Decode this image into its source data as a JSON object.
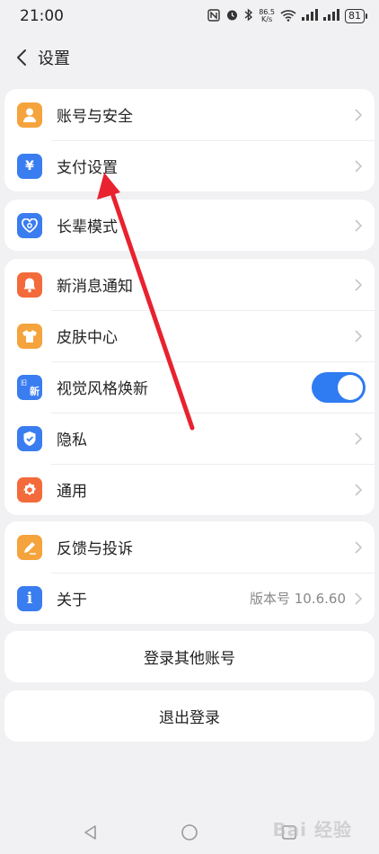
{
  "status": {
    "time": "21:00",
    "net_speed_top": "86.5",
    "net_speed_bottom": "K/s",
    "battery": "81"
  },
  "header": {
    "title": "设置"
  },
  "groups": {
    "account": {
      "account_security": {
        "label": "账号与安全",
        "icon": "person-icon",
        "color": "#f5a33c"
      },
      "payment": {
        "label": "支付设置",
        "icon": "yuan-icon",
        "color": "#3a7df0",
        "glyph": "¥"
      }
    },
    "elder": {
      "elder_mode": {
        "label": "长辈模式",
        "icon": "heart-icon",
        "color": "#3a7df0"
      }
    },
    "general": {
      "notifications": {
        "label": "新消息通知",
        "icon": "bell-icon",
        "color": "#f36b3b"
      },
      "skin": {
        "label": "皮肤中心",
        "icon": "shirt-icon",
        "color": "#f5a33c"
      },
      "visual_style": {
        "label": "视觉风格焕新",
        "icon": "new-style-icon",
        "color": "#3a7df0",
        "glyph_top": "旧",
        "glyph_bottom": "新",
        "toggle_on": true
      },
      "privacy": {
        "label": "隐私",
        "icon": "shield-icon",
        "color": "#3a7df0"
      },
      "common": {
        "label": "通用",
        "icon": "gear-icon",
        "color": "#f36b3b"
      }
    },
    "support": {
      "feedback": {
        "label": "反馈与投诉",
        "icon": "pencil-icon",
        "color": "#f5a33c"
      },
      "about": {
        "label": "关于",
        "icon": "info-icon",
        "color": "#3a7df0",
        "glyph": "i",
        "value": "版本号 10.6.60"
      }
    }
  },
  "buttons": {
    "login_other": "登录其他账号",
    "logout": "退出登录"
  },
  "colors": {
    "accent": "#2f7bf1",
    "annotation_arrow": "#e8222e"
  },
  "watermark": "Bai 经验"
}
